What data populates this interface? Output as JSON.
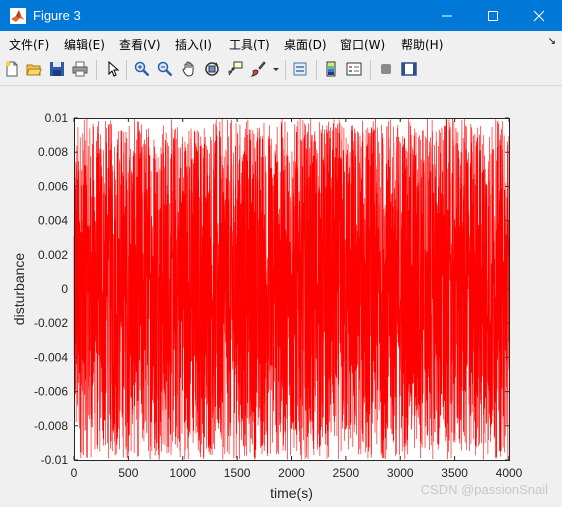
{
  "window": {
    "title": "Figure 3"
  },
  "menu": [
    "文件(F)",
    "编辑(E)",
    "查看(V)",
    "插入(I)",
    "工具(T)",
    "桌面(D)",
    "窗口(W)",
    "帮助(H)"
  ],
  "toolbar": {
    "icons": [
      "new-figure-icon",
      "open-file-icon",
      "save-icon",
      "print-icon",
      "edit-plot-icon",
      "zoom-in-icon",
      "zoom-out-icon",
      "pan-icon",
      "rotate-3d-icon",
      "data-cursor-icon",
      "brush-icon",
      "link-plot-icon",
      "colorbar-icon",
      "legend-icon",
      "hide-plot-tools-icon",
      "show-plot-tools-icon"
    ]
  },
  "colors": {
    "titlebar": "#0078d7",
    "series": "#ff0000"
  },
  "chart_data": {
    "type": "line",
    "xlabel": "time(s)",
    "ylabel": "disturbance",
    "xlim": [
      0,
      4000
    ],
    "ylim": [
      -0.01,
      0.01
    ],
    "xticks": [
      0,
      500,
      1000,
      1500,
      2000,
      2500,
      3000,
      3500,
      4000
    ],
    "yticks": [
      -0.01,
      -0.008,
      -0.006,
      -0.004,
      -0.002,
      0,
      0.002,
      0.004,
      0.006,
      0.008,
      0.01
    ],
    "ytick_labels": [
      "-0.01",
      "-0.008",
      "-0.006",
      "-0.004",
      "-0.002",
      "0",
      "0.002",
      "0.004",
      "0.006",
      "0.008",
      "0.01"
    ],
    "series": [
      {
        "description": "uniform random disturbance in [-0.01, 0.01], one sample per second, 4000 samples",
        "color": "#ff0000"
      }
    ]
  },
  "watermark": "CSDN @passionSnail"
}
